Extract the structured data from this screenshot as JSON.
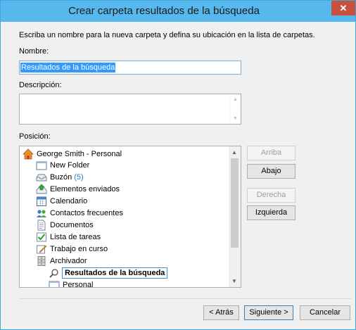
{
  "window": {
    "title": "Crear carpeta resultados de la  búsqueda",
    "close_glyph": "✕"
  },
  "form": {
    "instructions": "Escriba un nombre para la nueva carpeta y defina su ubicación en la lista de carpetas.",
    "name_label": "Nombre:",
    "name_value": "Resultados de la búsqueda",
    "description_label": "Descripción:",
    "description_value": "",
    "position_label": "Posición:"
  },
  "tree": {
    "items": [
      {
        "label": "George Smith - Personal",
        "icon": "home-icon"
      },
      {
        "label": "New Folder",
        "icon": "folder-icon"
      },
      {
        "label": "Buzón",
        "count": "(5)",
        "icon": "inbox-icon"
      },
      {
        "label": "Elementos enviados",
        "icon": "sent-items-icon"
      },
      {
        "label": "Calendario",
        "icon": "calendar-icon"
      },
      {
        "label": "Contactos frecuentes",
        "icon": "contacts-icon"
      },
      {
        "label": "Documentos",
        "icon": "documents-icon"
      },
      {
        "label": "Lista de tareas",
        "icon": "tasks-icon"
      },
      {
        "label": "Trabajo en curso",
        "icon": "work-in-progress-icon"
      },
      {
        "label": "Archivador",
        "icon": "archive-icon"
      },
      {
        "label": "Resultados de la búsqueda",
        "icon": "search-folder-icon",
        "selected": true
      },
      {
        "label": "Personal",
        "icon": "folder-icon"
      }
    ]
  },
  "side_buttons": {
    "up": "Arriba",
    "down": "Abajo",
    "right": "Derecha",
    "left": "Izquierda"
  },
  "footer": {
    "back": "< Atrás",
    "next": "Siguiente >",
    "cancel": "Cancelar"
  },
  "colors": {
    "titlebar": "#56b8ec",
    "close": "#c7503f",
    "selection": "#3399ff",
    "count": "#1a7fd0"
  }
}
